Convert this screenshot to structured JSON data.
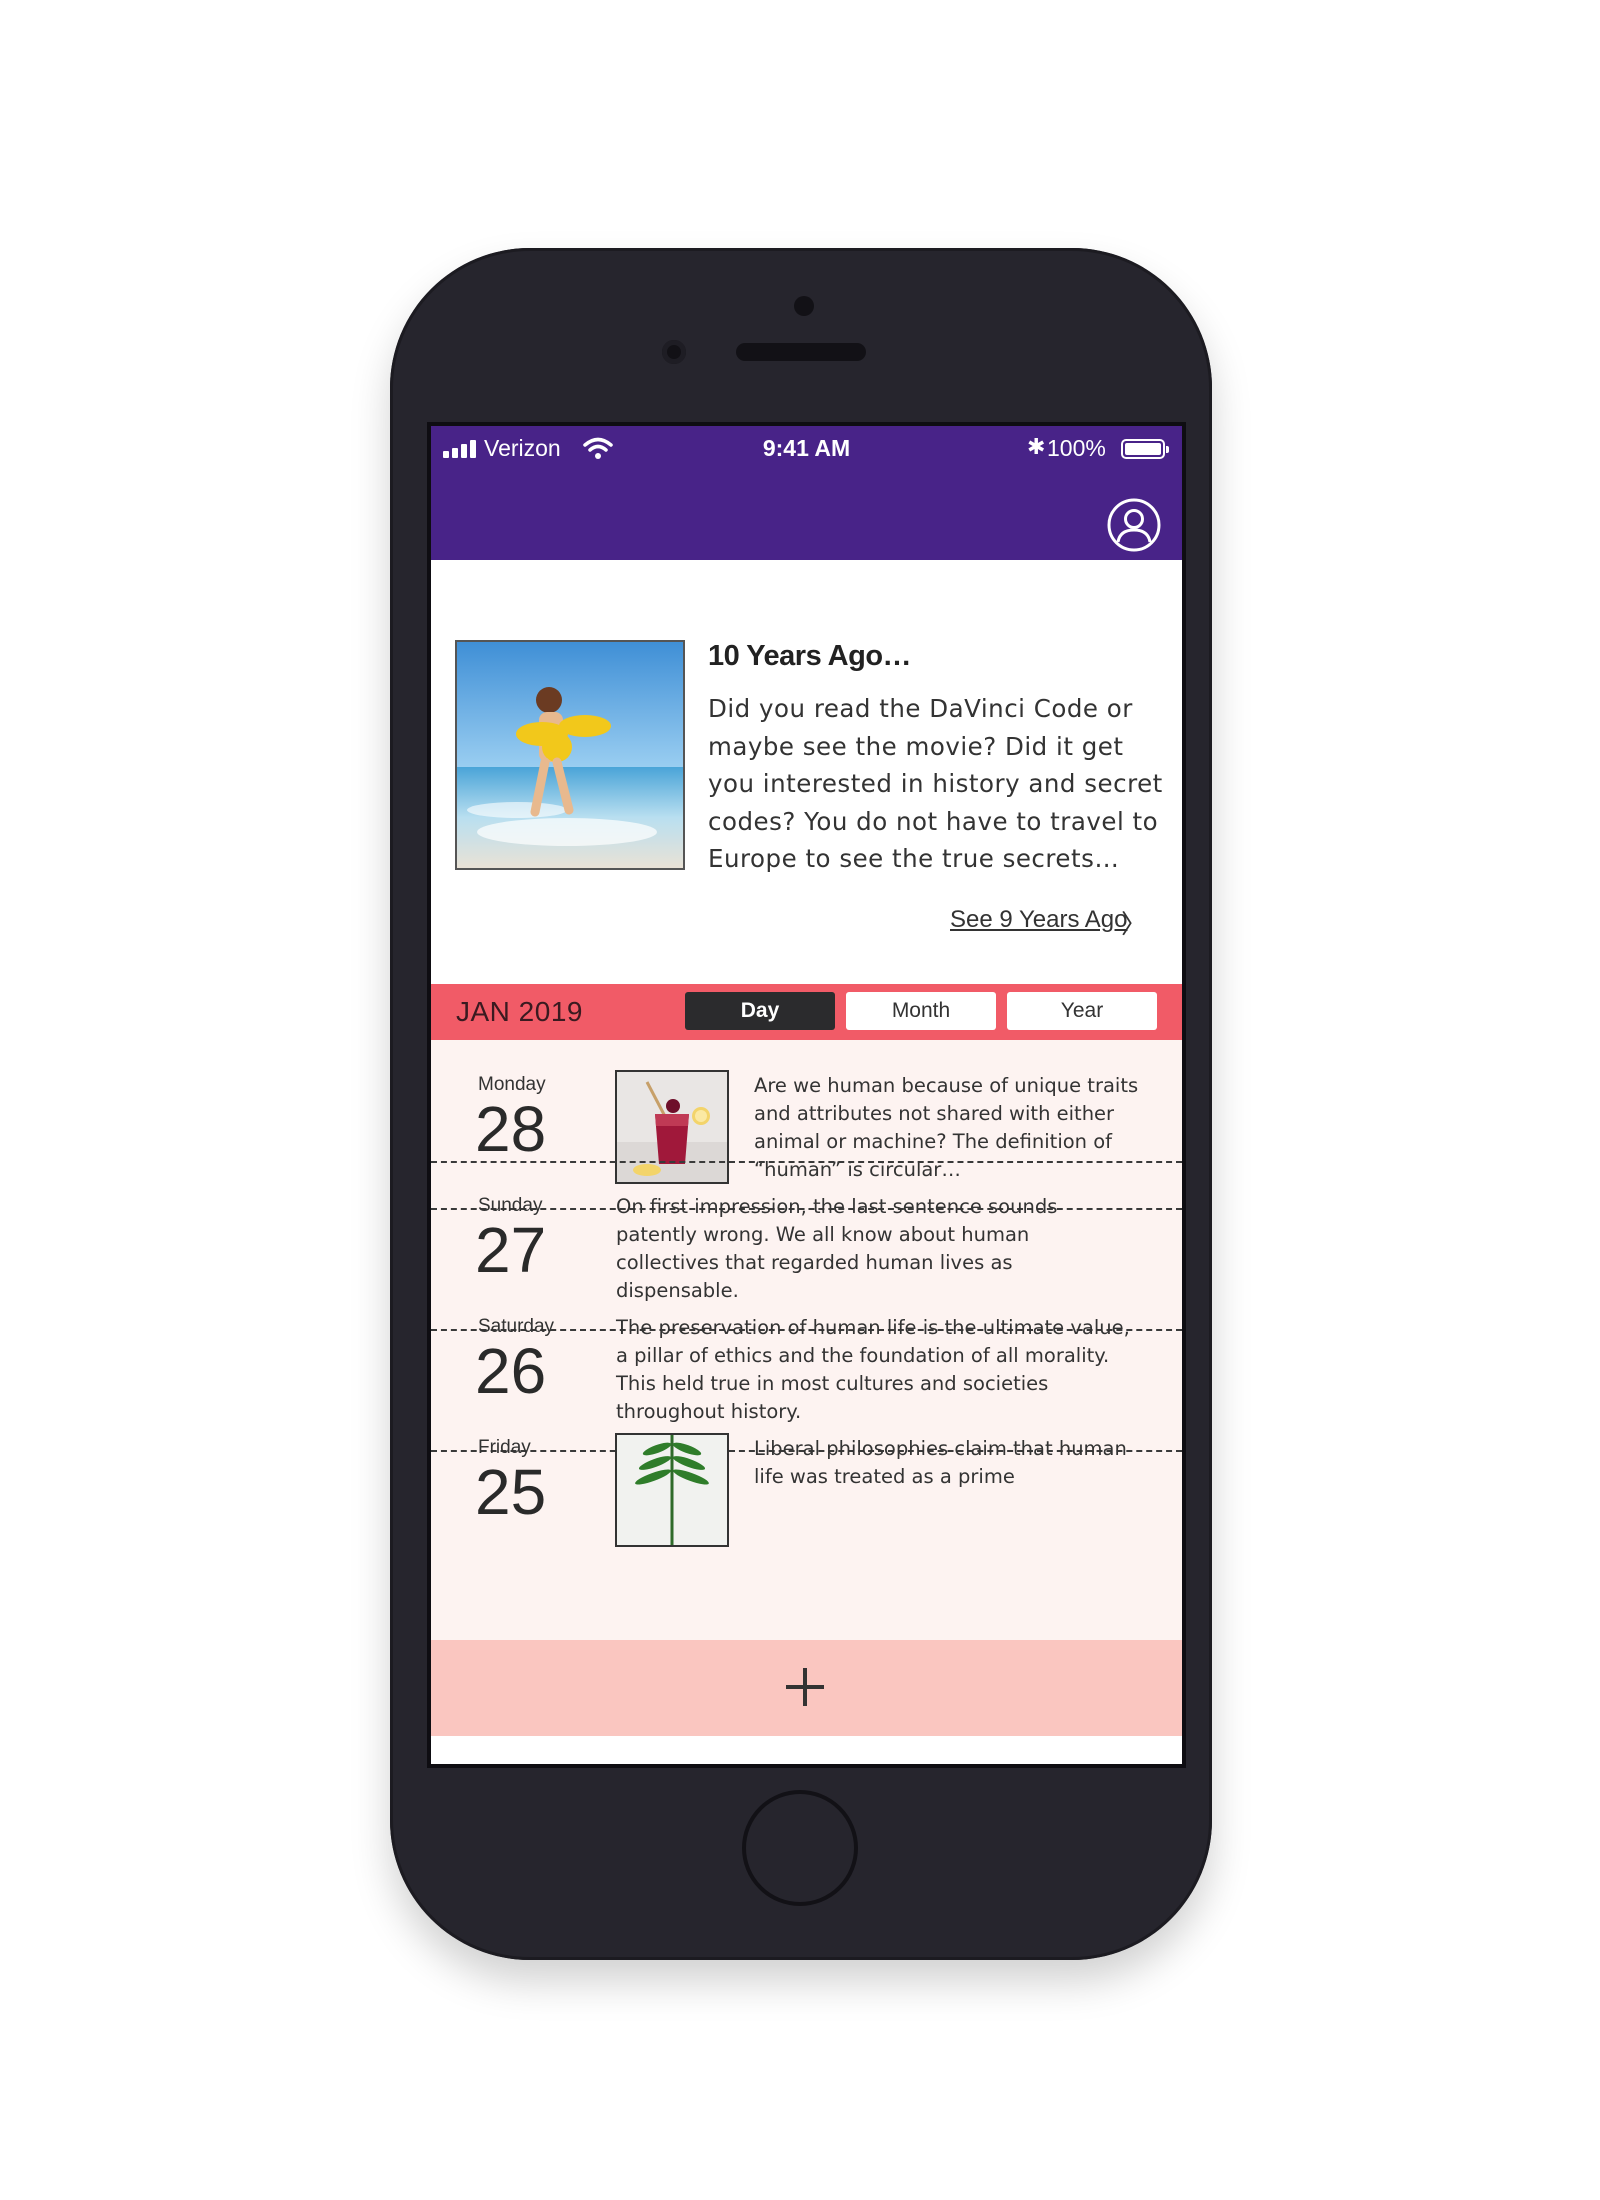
{
  "status_bar": {
    "carrier": "Verizon",
    "time": "9:41 AM",
    "battery": "100%",
    "bluetooth_icon": "bluetooth-icon"
  },
  "colors": {
    "header": "#482388",
    "month_bar": "#f15b67",
    "list_bg": "#fdf3f1",
    "add_bar": "#fac6c0"
  },
  "memory": {
    "title": "10 Years Ago…",
    "text": "Did you read the DaVinci Code or maybe see the movie? Did it get you interested in history and secret codes? You do not have to travel to Europe to see the true secrets…",
    "link": "See 9 Years Ago",
    "link_chevron": "〉"
  },
  "calendar": {
    "month_label": "JAN 2019",
    "view_options": [
      "Day",
      "Month",
      "Year"
    ],
    "selected_view": "Day"
  },
  "entries": [
    {
      "day_name": "Monday",
      "day_num": "28",
      "text": "Are we human because of unique traits and attributes not shared with either animal or machine? The definition of “human” is circular…",
      "image": "berry-drink-photo"
    },
    {
      "day_name": "Sunday",
      "day_num": "27",
      "text": "On first impression, the last sentence sounds patently wrong. We all know about human collectives that regarded human lives as dispensable."
    },
    {
      "day_name": "Saturday",
      "day_num": "26",
      "text": "The preservation of human life is the ultimate value, a pillar of ethics and the foundation of all morality. This held true in most cultures and societies throughout history."
    },
    {
      "day_name": "Friday",
      "day_num": "25",
      "text": "Liberal philosophies claim that human life was treated as a prime",
      "image": "fern-leaf-photo"
    }
  ],
  "add_button": {
    "icon": "plus-icon"
  }
}
